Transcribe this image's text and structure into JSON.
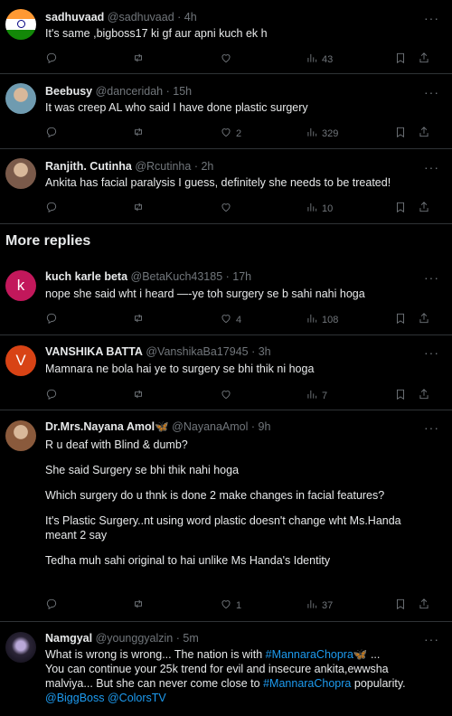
{
  "section_title": "More replies",
  "tweets": [
    {
      "name": "sadhuvaad",
      "handle": "@sadhuvaad",
      "time": "4h",
      "lines": [
        "It's  same ,bigboss17 ki gf aur apni kuch ek h"
      ],
      "replies": "",
      "retweets": "",
      "likes": "",
      "views": "43",
      "avatar": {
        "type": "flag"
      }
    },
    {
      "name": "Beebusy",
      "handle": "@danceridah",
      "time": "15h",
      "lines": [
        "It was creep AL who said I have done plastic surgery"
      ],
      "replies": "",
      "retweets": "",
      "likes": "2",
      "views": "329",
      "avatar": {
        "type": "photo",
        "color": "#6f9bb0"
      }
    },
    {
      "name": "Ranjith. Cutinha",
      "handle": "@Rcutinha",
      "time": "2h",
      "lines": [
        "Ankita has facial paralysis I guess, definitely she needs to be treated!"
      ],
      "replies": "",
      "retweets": "",
      "likes": "",
      "views": "10",
      "avatar": {
        "type": "photo",
        "color": "#7a5a4a"
      }
    },
    {
      "name": "kuch karle beta",
      "handle": "@BetaKuch43185",
      "time": "17h",
      "lines": [
        "nope she said wht i heard —-ye toh surgery se b sahi nahi hoga"
      ],
      "replies": "",
      "retweets": "",
      "likes": "4",
      "views": "108",
      "avatar": {
        "type": "letter",
        "letter": "k",
        "color": "#c2185b"
      }
    },
    {
      "name": "VANSHIKA BATTA",
      "handle": "@VanshikaBa17945",
      "time": "3h",
      "lines": [
        "Mamnara ne bola hai ye to surgery se bhi thik ni hoga"
      ],
      "replies": "",
      "retweets": "",
      "likes": "",
      "views": "7",
      "avatar": {
        "type": "letter",
        "letter": "V",
        "color": "#d84315"
      }
    },
    {
      "name": "Dr.Mrs.Nayana Amol🦋",
      "handle": "@NayanaAmol",
      "time": "9h",
      "lines": [
        "R u deaf with Blind & dumb?",
        "",
        "She said Surgery se bhi thik nahi hoga",
        "",
        "Which surgery do u thnk is done 2 make changes in facial features?",
        "",
        "It's Plastic Surgery..nt using word plastic doesn't change wht Ms.Handa",
        "meant 2 say",
        "",
        "Tedha muh sahi original to hai unlike Ms Handa's Identity"
      ],
      "replies": "",
      "retweets": "",
      "likes": "1",
      "views": "37",
      "avatar": {
        "type": "photo",
        "color": "#8a5a3c"
      }
    }
  ],
  "last_tweet": {
    "name": "Namgyal",
    "handle": "@younggyalzin",
    "time": "5m",
    "line1": "What is wrong is wrong... The nation is with ",
    "tag1": "#MannaraChopra",
    "line1_end": "🦋 ...",
    "line2": "You can continue your 25k trend for evil and insecure ankita,ewwsha",
    "line3a": "malviya... But she can never come close to ",
    "tag2": "#MannaraChopra",
    "line3b": " popularity.",
    "mention1": "@BiggBoss",
    "mention2": "@ColorsTV"
  }
}
